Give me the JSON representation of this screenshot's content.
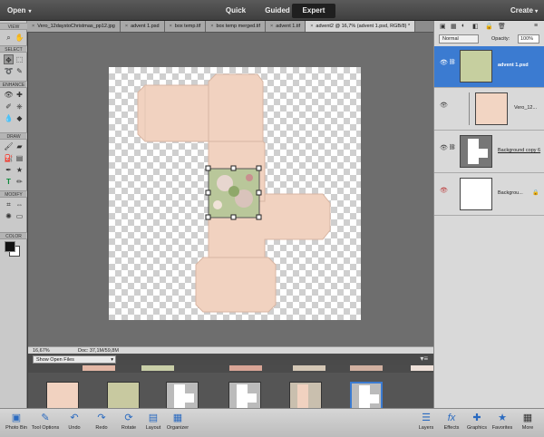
{
  "topbar": {
    "open_label": "Open",
    "modes": [
      "Quick",
      "Guided",
      "Expert"
    ],
    "create_label": "Create"
  },
  "tabs": [
    "Vero_12daystoChristmas_pp12.jpg",
    "advent 1.psd",
    "box temp.tif",
    "box temp merged.tif",
    "advent 1.tif",
    "advent2 @ 16,7% (advent 1.psd, RGB/8) *"
  ],
  "toolbar": {
    "sections": [
      "VIEW",
      "SELECT",
      "ENHANCE",
      "DRAW",
      "MODIFY",
      "COLOR"
    ]
  },
  "statusbar": {
    "zoom": "16,67%",
    "doc": "Doc: 37,1M/59,8M"
  },
  "bin": {
    "selector": "Show Open Files"
  },
  "layers_panel": {
    "blend_mode": "Normal",
    "opacity_label": "Opacity:",
    "opacity_value": "100%",
    "layers": [
      {
        "name": "advent 1.psd",
        "selected": true
      },
      {
        "name": "Vero_12...",
        "selected": false
      },
      {
        "name": "Background copy 6",
        "selected": false
      },
      {
        "name": "Backgrou...",
        "selected": false
      }
    ]
  },
  "bottom_bar": {
    "left": [
      {
        "label": "Photo Bin",
        "icon": "photo-bin-icon"
      },
      {
        "label": "Tool Options",
        "icon": "tool-options-icon"
      },
      {
        "label": "Undo",
        "icon": "undo-icon"
      },
      {
        "label": "Redo",
        "icon": "redo-icon"
      },
      {
        "label": "Rotate",
        "icon": "rotate-icon"
      },
      {
        "label": "Layout",
        "icon": "layout-icon"
      },
      {
        "label": "Organizer",
        "icon": "organizer-icon"
      }
    ],
    "right": [
      {
        "label": "Layers",
        "icon": "layers-icon"
      },
      {
        "label": "Effects",
        "icon": "effects-icon"
      },
      {
        "label": "Graphics",
        "icon": "graphics-icon"
      },
      {
        "label": "Favorites",
        "icon": "favorites-icon"
      },
      {
        "label": "More",
        "icon": "more-icon"
      }
    ]
  },
  "colors": {
    "accent": "#2a6ac0",
    "paper": "#f1d2c0",
    "selected_layer": "#3b7bd1"
  }
}
